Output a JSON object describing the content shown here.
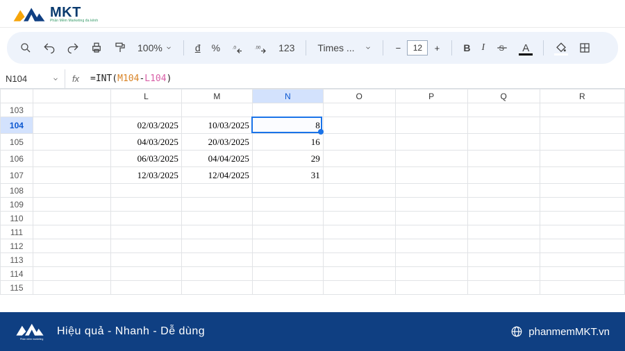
{
  "logo": {
    "brand": "MKT",
    "tagline": "Phần Mềm Marketing đa kênh"
  },
  "toolbar": {
    "zoom": "100%",
    "currency": "đ",
    "percent": "%",
    "decDecrease": ".0←",
    "decIncrease": ".00→",
    "numfmt": "123",
    "font": "Times ...",
    "fontSize": "12",
    "bold": "B",
    "italic": "I",
    "textcolor": "A"
  },
  "namebox": "N104",
  "formula": {
    "prefix": "=INT(",
    "ref1": "M104",
    "dash": "-",
    "ref2": "L104",
    "suffix": ")"
  },
  "columns": [
    "",
    "L",
    "M",
    "N",
    "O",
    "P",
    "Q",
    "R"
  ],
  "rows": [
    {
      "n": "103",
      "L": "",
      "M": "",
      "N": ""
    },
    {
      "n": "104",
      "L": "02/03/2025",
      "M": "10/03/2025",
      "N": "8"
    },
    {
      "n": "105",
      "L": "04/03/2025",
      "M": "20/03/2025",
      "N": "16"
    },
    {
      "n": "106",
      "L": "06/03/2025",
      "M": "04/04/2025",
      "N": "29"
    },
    {
      "n": "107",
      "L": "12/03/2025",
      "M": "12/04/2025",
      "N": "31"
    },
    {
      "n": "108",
      "L": "",
      "M": "",
      "N": ""
    },
    {
      "n": "109",
      "L": "",
      "M": "",
      "N": ""
    },
    {
      "n": "110",
      "L": "",
      "M": "",
      "N": ""
    },
    {
      "n": "111",
      "L": "",
      "M": "",
      "N": ""
    },
    {
      "n": "112",
      "L": "",
      "M": "",
      "N": ""
    },
    {
      "n": "113",
      "L": "",
      "M": "",
      "N": ""
    },
    {
      "n": "114",
      "L": "",
      "M": "",
      "N": ""
    },
    {
      "n": "115",
      "L": "",
      "M": "",
      "N": ""
    }
  ],
  "selectedColIndex": 3,
  "selectedRowIndex": 1,
  "footer": {
    "slogan": "Hiệu quả - Nhanh  - Dễ dùng",
    "site": "phanmemMKT.vn"
  }
}
